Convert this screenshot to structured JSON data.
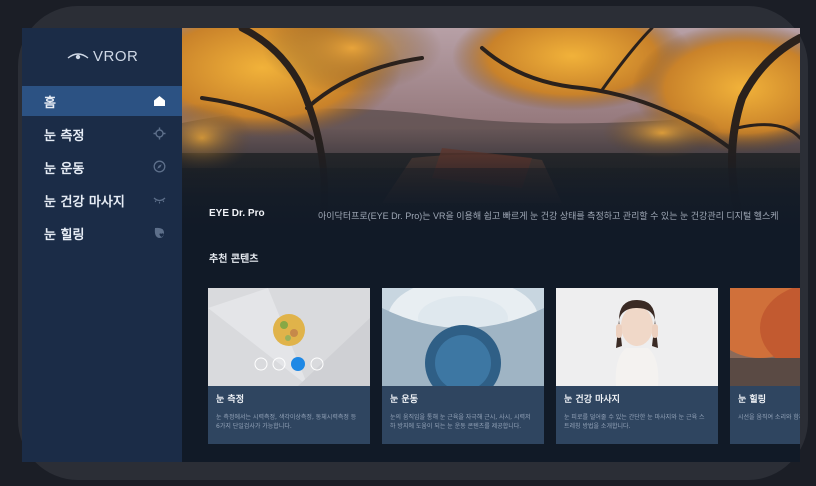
{
  "app": {
    "logo_text": "VROR"
  },
  "sidebar": {
    "items": [
      {
        "label": "홈",
        "icon": "home-icon",
        "active": true
      },
      {
        "label": "눈 측정",
        "icon": "crosshair-icon",
        "active": false
      },
      {
        "label": "눈 운동",
        "icon": "compass-icon",
        "active": false
      },
      {
        "label": "눈 건강 마사지",
        "icon": "eye-closed-icon",
        "active": false
      },
      {
        "label": "눈 힐링",
        "icon": "leaf-heart-icon",
        "active": false
      }
    ]
  },
  "hero": {
    "brand": "EYE Dr. Pro",
    "description": "아이닥터프로(EYE Dr. Pro)는 VR을 이용해 쉽고 빠르게 눈 건강 상태를 측정하고 관리할 수 있는 눈 건강관리 디지털 헬스케"
  },
  "recommended": {
    "title": "추천 콘텐츠",
    "cards": [
      {
        "title": "눈 측정",
        "text": "눈 측정에서는 시력측정, 색각이상측정, 동체시력측정 등 6가지 단일검사가 가능합니다."
      },
      {
        "title": "눈 운동",
        "text": "눈의 움직임을 통해 눈 근육을 자극해 근시, 사시, 시력저하 방지에 도움이 되는 눈 운동 콘텐츠를 제공합니다."
      },
      {
        "title": "눈 건강 마사지",
        "text": "눈 피로를 덜어줄 수 있는 간단한 눈 마사지와 눈 근육 스트레칭 방법을 소개합니다."
      },
      {
        "title": "눈 힐링",
        "text": "시선을 움직여 소리와 함께 ... 프로그램을 체험합니다"
      }
    ]
  },
  "colors": {
    "sidebar_bg": "#1b2c47",
    "active_bg": "#2c5283",
    "accent": "#1e88e5"
  }
}
